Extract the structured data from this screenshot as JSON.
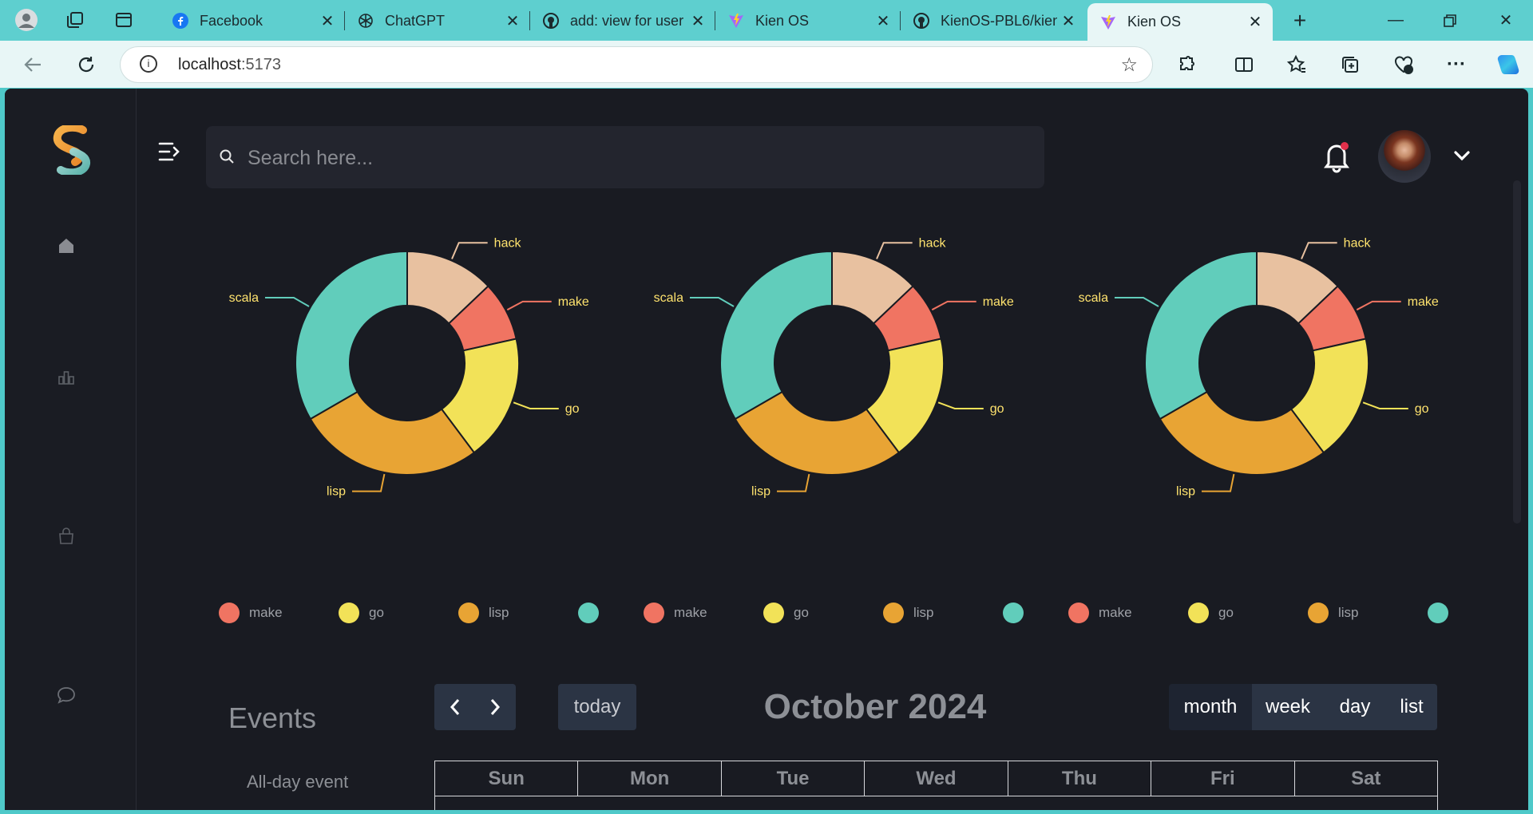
{
  "browser": {
    "tabs": [
      {
        "label": "Facebook",
        "icon": "facebook-icon"
      },
      {
        "label": "ChatGPT",
        "icon": "chatgpt-icon"
      },
      {
        "label": "add: view for user",
        "icon": "github-icon"
      },
      {
        "label": "Kien OS",
        "icon": "vite-icon"
      },
      {
        "label": "KienOS-PBL6/kien",
        "icon": "github-icon"
      },
      {
        "label": "Kien OS",
        "icon": "vite-icon",
        "active": true
      }
    ],
    "url_host": "localhost",
    "url_port": ":5173"
  },
  "app": {
    "search_placeholder": "Search here...",
    "sidebar": [
      "home-icon",
      "chart-icon",
      "bag-icon",
      "chat-icon"
    ],
    "colors": {
      "make": "#f07462",
      "go": "#f2e258",
      "lisp": "#e8a434",
      "scala": "#61cdbb",
      "hack": "#e8c1a0",
      "notification": "#e2304b",
      "label_text": "#ffe36e"
    }
  },
  "chart_data": [
    {
      "type": "pie",
      "donut": true,
      "labels": [
        "hack",
        "make",
        "go",
        "lisp",
        "scala"
      ],
      "values": [
        12,
        8,
        17,
        25,
        31
      ]
    },
    {
      "type": "pie",
      "donut": true,
      "labels": [
        "hack",
        "make",
        "go",
        "lisp",
        "scala"
      ],
      "values": [
        12,
        8,
        17,
        25,
        31
      ]
    },
    {
      "type": "pie",
      "donut": true,
      "labels": [
        "hack",
        "make",
        "go",
        "lisp",
        "scala"
      ],
      "values": [
        12,
        8,
        17,
        25,
        31
      ]
    }
  ],
  "legend": [
    [
      "make",
      "go",
      "lisp",
      ""
    ],
    [
      "make",
      "go",
      "lisp",
      ""
    ],
    [
      "make",
      "go",
      "lisp",
      ""
    ]
  ],
  "calendar": {
    "events_title": "Events",
    "all_day_label": "All-day event",
    "today_label": "today",
    "title": "October 2024",
    "views": [
      "month",
      "week",
      "day",
      "list"
    ],
    "days": [
      "Sun",
      "Mon",
      "Tue",
      "Wed",
      "Thu",
      "Fri",
      "Sat"
    ]
  }
}
